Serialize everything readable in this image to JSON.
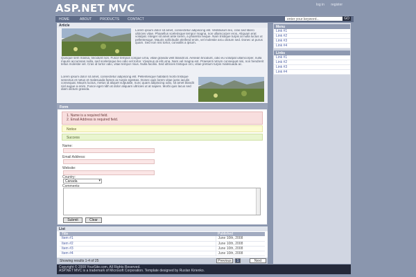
{
  "header": {
    "logo": "ASP.NET MVC",
    "links": [
      "log in",
      "register"
    ]
  },
  "nav": {
    "items": [
      "HOME",
      "ABOUT",
      "PRODUCTS",
      "CONTACT"
    ]
  },
  "search": {
    "placeholder": "enter your keyword...",
    "button": "GO"
  },
  "article": {
    "title": "Article",
    "text1": "Lorem ipsum dolor sit amet, consectetur adipiscing elit. Vestibulum leo, cras sed libero ultricies vitae. Phasellus scelerisque tempor magna, non ullamcorper eros. Aliquam erat volutpat. Integer sit amet ante lorem, a pharetra neque. Nam tristique turpis at nulla luctus ut pellentesque. Mauris sollicitudin eleifend enim, vel molestie arcu dictum sed. Donec ut purus quam. Sed non nisi tortor, convallis a ipsum.",
    "text2": "Quisque sem massa, tincidunt non. Fusce tempus congue urna, vitae gravida velit blandit at. Aenean tincidunt, odio eu volutpat ullamcorper, nulla mauris accumsan nulla, sed scelerisque leo odio vel tortor. Vivamus at elit urna. Nam vel magna est. Praesent rutrum consequat nisi, non hendrerit tellus molestie vel. Cras id tortor odio, vitae tempor risus. Nulla facilisi. Sed ultricies tristique orci, vitae pretium turpis malesuada ac.",
    "text3": "Lorem ipsum dolor sit amet, consectetur adipiscing elit. Pellentesque habitant morbi tristique senectus et netus et malesuada fames ac turpis egestas. Donec quis lorem vitae justo iaculis consequat. Mauris luctus, metus id aliquet vulputate, nunc quam adipiscing odio, sit amet blandit nisl augue a enim. Fusce eget nibh at dolor aliquam ultricies ut at sapien. Morbi quis lacus sed diam dictum gravida."
  },
  "form": {
    "title": "Form",
    "errors": [
      "Name is a required field.",
      "Email Address is required field."
    ],
    "notice": "Notice",
    "success": "Success",
    "labels": {
      "name": "Name:",
      "email": "Email Address:",
      "website": "Website:",
      "country": "Country:",
      "comments": "Comments:"
    },
    "country_value": "Canada",
    "submit": "Submit",
    "clear": "Clear"
  },
  "list": {
    "title": "List",
    "columns": [
      "Title",
      "Published"
    ],
    "rows": [
      {
        "title": "Item #1",
        "published": "June 10th, 2008"
      },
      {
        "title": "Item #2",
        "published": "June 10th, 2008"
      },
      {
        "title": "Item #3",
        "published": "June 10th, 2008"
      },
      {
        "title": "Item #4",
        "published": "June 10th, 2008"
      }
    ],
    "pager_info": "Showing results 1-4 of 25",
    "prev": "Previous",
    "page": "1",
    "next": "Next"
  },
  "sidebar": {
    "menu_title": "Menu",
    "menu_links": [
      "Link #1",
      "Link #2",
      "Link #3",
      "Link #4"
    ],
    "links_title": "Links",
    "links": [
      "Link #1",
      "Link #2",
      "Link #3",
      "Link #4"
    ]
  },
  "footer": {
    "line1": "Copyright © 2008 YourSite.com. All Rights Reserved.",
    "line2": "ASP.NET MVC is a trademark of Microsoft Corporation. Template designed by Ruslan Kirienko."
  },
  "colors": {
    "background": "#8a96ae",
    "nav": "#5e6b87",
    "footer": "#24293a",
    "error": "#f8dede",
    "notice": "#fcfbd3",
    "success": "#e9f5cf"
  }
}
